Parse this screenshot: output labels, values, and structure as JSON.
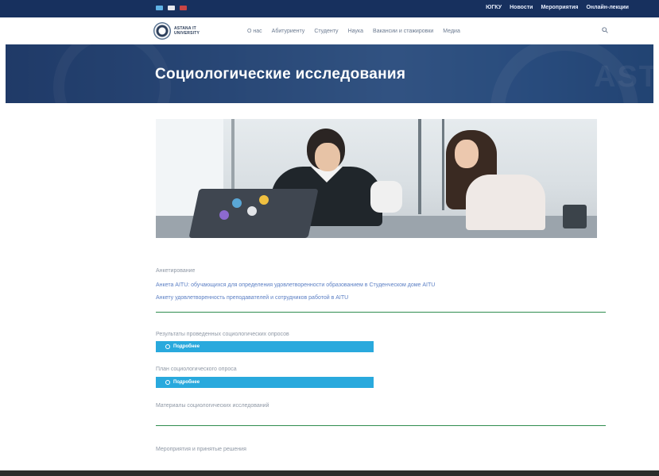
{
  "topbar": {
    "flags": [
      {
        "name": "kz-flag-icon",
        "color": "#5fb2e6"
      },
      {
        "name": "ru-flag-icon",
        "color": "#e5e7ee"
      },
      {
        "name": "en-flag-icon",
        "color": "#c84545"
      }
    ],
    "links": [
      "ЮГКУ",
      "Новости",
      "Мероприятия",
      "Онлайн-лекции"
    ]
  },
  "logo": {
    "line1": "ASTANA IT",
    "line2": "UNIVERSITY"
  },
  "nav": {
    "items": [
      "О нас",
      "Абитуриенту",
      "Студенту",
      "Наука",
      "Вакансии и стажировки",
      "Медиа"
    ]
  },
  "hero": {
    "title": "Социологические исследования"
  },
  "photo": {
    "description_icon": "students-laptop-photo"
  },
  "content": {
    "section_label": "Анкетирование",
    "links": [
      "Анкета AITU: обучающихся для определения удовлетворенности образованием в Студенческом доме AITU",
      "Анкету удовлетворенность преподавателей и сотрудников работой в AITU"
    ],
    "block1": {
      "label": "Результаты проведенных социологических опросов",
      "button": "Подробнее"
    },
    "block2": {
      "label": "План социологического опроса",
      "button": "Подробнее"
    },
    "block3": {
      "label": "Материалы социологических исследований"
    },
    "block4": {
      "label": "Мероприятия и принятые решения"
    }
  },
  "colors": {
    "topbar": "#17305e",
    "accent_button": "#29a9dd",
    "divider": "#2f8d4f",
    "link": "#5b7fc4"
  }
}
